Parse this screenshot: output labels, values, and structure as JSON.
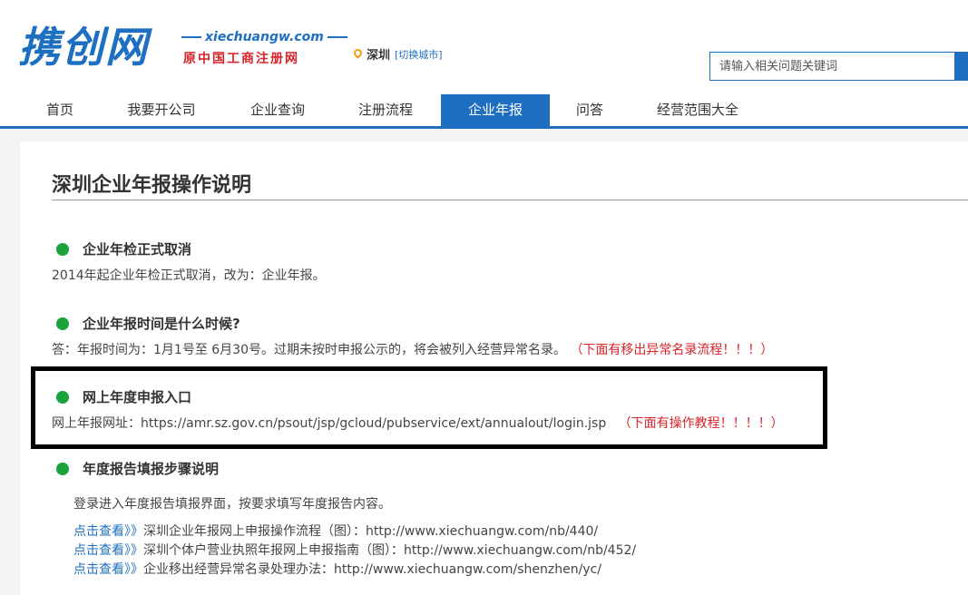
{
  "header": {
    "logo": "携创网",
    "domain": "xiechuangw.com",
    "tagline": "原中国工商注册网",
    "city": "深圳",
    "city_switch": "[切换城市]",
    "search_placeholder": "请输入相关问题关键词"
  },
  "nav": [
    {
      "label": "首页"
    },
    {
      "label": "我要开公司"
    },
    {
      "label": "企业查询"
    },
    {
      "label": "注册流程"
    },
    {
      "label": "企业年报"
    },
    {
      "label": "问答"
    },
    {
      "label": "经营范围大全"
    }
  ],
  "article": {
    "title": "深圳企业年报操作说明",
    "sections": [
      {
        "heading": "企业年检正式取消",
        "body": "2014年起企业年检正式取消，改为：企业年报。"
      },
      {
        "heading": "企业年报时间是什么时候?",
        "body": "答：年报时间为：1月1号至 6月30号。过期未按时申报公示的，将会被列入经营异常名录。",
        "note": "（下面有移出异常名录流程！！！）"
      },
      {
        "heading": "网上年度申报入口",
        "body": "网上年报网址：https://amr.sz.gov.cn/psout/jsp/gcloud/pubservice/ext/annualout/login.jsp",
        "note": "（下面有操作教程！！！！）"
      },
      {
        "heading": "年度报告填报步骤说明",
        "body": "登录进入年度报告填报界面，按要求填写年度报告内容。"
      }
    ],
    "links": [
      {
        "prefix": "点击查看》》",
        "text": "深圳企业年报网上申报操作流程（图）：http://www.xiechuangw.com/nb/440/"
      },
      {
        "prefix": "点击查看》》",
        "text": "深圳个体户营业执照年报网上申报指南（图）：http://www.xiechuangw.com/nb/452/"
      },
      {
        "prefix": "点击查看》》",
        "text": "企业移出经营异常名录处理办法：http://www.xiechuangw.com/shenzhen/yc/"
      }
    ]
  },
  "colors": {
    "brand": "#1e6fc1",
    "accent_red": "#d8232a",
    "bullet_green": "#1aa33a"
  }
}
